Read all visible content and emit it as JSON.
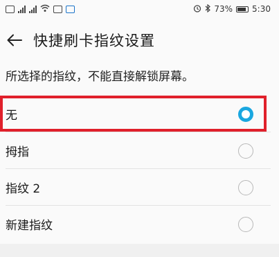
{
  "status_bar": {
    "left_icons": [
      "notification-icon",
      "signal-icon",
      "signal-icon",
      "wifi-icon",
      "nfc-icon",
      "app-icon"
    ],
    "right_icons": [
      "alarm-icon",
      "bluetooth-icon"
    ],
    "battery": "73%",
    "time": "5:30"
  },
  "header": {
    "back_icon": "arrow-left-icon",
    "title": "快捷刷卡指纹设置"
  },
  "description": "所选择的指纹，不能直接解锁屏幕。",
  "options": [
    {
      "label": "无",
      "selected": true
    },
    {
      "label": "拇指",
      "selected": false
    },
    {
      "label": "指纹 2",
      "selected": false
    },
    {
      "label": "新建指纹",
      "selected": false
    }
  ],
  "colors": {
    "radio_selected": "#1aa7e0",
    "highlight_border": "#e0202b"
  }
}
